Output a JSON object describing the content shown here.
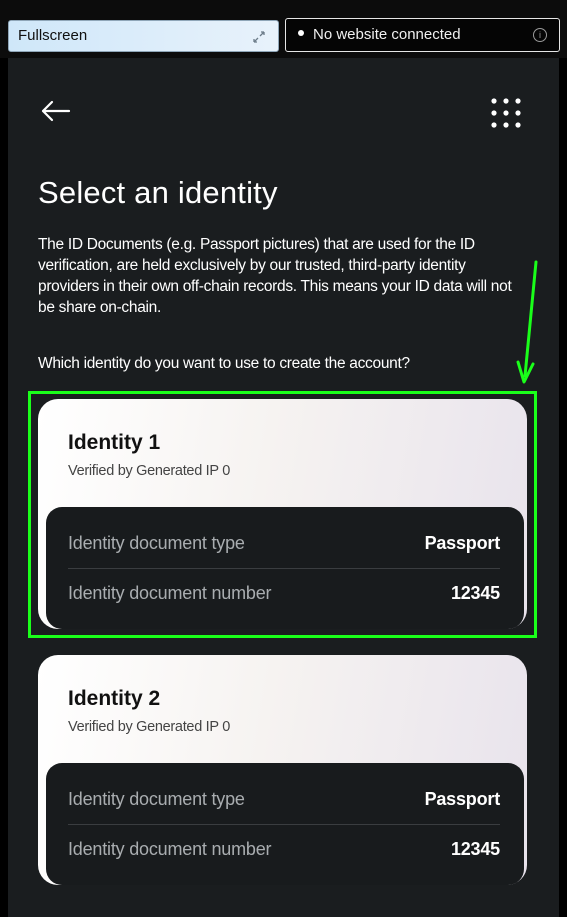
{
  "topbar": {
    "fullscreen_label": "Fullscreen",
    "connection_status": "No website connected"
  },
  "header": {
    "back_icon": "arrow-left-icon",
    "menu_icon": "grid-dots-icon"
  },
  "page": {
    "title": "Select an identity",
    "description": "The ID Documents (e.g. Passport pictures) that are used for the ID verification, are held exclusively by our trusted, third-party identity providers in their own off-chain records. This means your ID data will not be share on-chain.",
    "question": "Which identity do you want to use to create the account?"
  },
  "identities": [
    {
      "name": "Identity 1",
      "verified_by": "Verified by Generated IP 0",
      "doc_type_label": "Identity document type",
      "doc_type_value": "Passport",
      "doc_number_label": "Identity document number",
      "doc_number_value": "12345"
    },
    {
      "name": "Identity 2",
      "verified_by": "Verified by Generated IP 0",
      "doc_type_label": "Identity document type",
      "doc_type_value": "Passport",
      "doc_number_label": "Identity document number",
      "doc_number_value": "12345"
    }
  ],
  "colors": {
    "annotation": "#1aff1a",
    "app_background": "#1a1d1f",
    "details_background": "#181b1d"
  }
}
